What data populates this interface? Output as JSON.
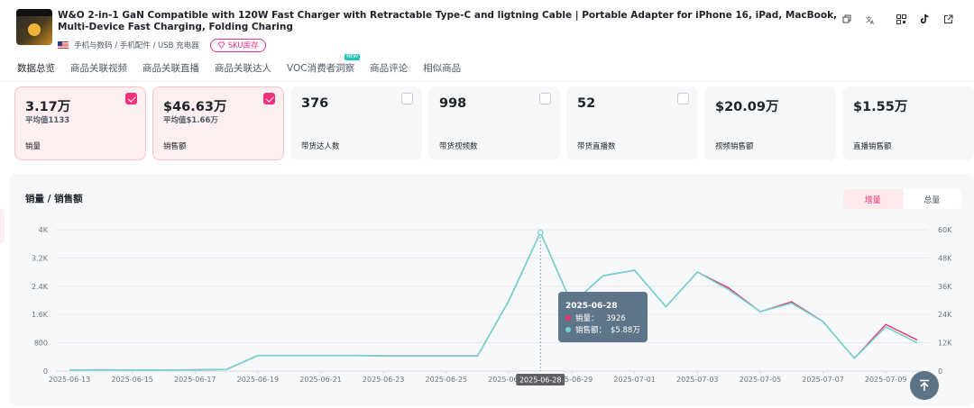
{
  "product": {
    "title": "W&O 2-in-1 GaN Compatible with 120W Fast Charger with Retractable Type-C and ligtning Cable | Portable Adapter for iPhone 16, iPad, MacBook, Multi-Device Fast Charging, Folding Charing",
    "category_path": "手机与数码 / 手机配件 / USB 充电器",
    "sku_label": "SKU库存",
    "header_icons": [
      "copy-icon",
      "translate-icon",
      "qr-code-icon",
      "tiktok-icon",
      "external-link-icon"
    ]
  },
  "tabs": [
    {
      "label": "数据总览",
      "active": true
    },
    {
      "label": "商品关联视频"
    },
    {
      "label": "商品关联直播"
    },
    {
      "label": "商品关联达人"
    },
    {
      "label": "VOC消费者洞察",
      "badge": "NEW"
    },
    {
      "label": "商品评论"
    },
    {
      "label": "相似商品"
    }
  ],
  "metrics": [
    {
      "value": "3.17万",
      "sub": "平均值1133",
      "label": "销量",
      "selected": true
    },
    {
      "value": "$46.63万",
      "sub": "平均值$1.66万",
      "label": "销售额",
      "selected": true
    },
    {
      "value": "376",
      "sub": "",
      "label": "带货达人数",
      "selected": false
    },
    {
      "value": "998",
      "sub": "",
      "label": "带货视频数",
      "selected": false
    },
    {
      "value": "52",
      "sub": "",
      "label": "带货直播数",
      "selected": false
    },
    {
      "value": "$20.09万",
      "sub": "",
      "label": "视频销售额",
      "selected": false
    },
    {
      "value": "$1.55万",
      "sub": "",
      "label": "直播销售额",
      "selected": false
    }
  ],
  "chart_panel": {
    "title": "销量 / 销售额",
    "toggle": [
      "增量",
      "总量"
    ],
    "active_toggle": "增量"
  },
  "colors": {
    "accent": "#f0307a",
    "sales_volume": "#e8356b",
    "sales_amount": "#6fd3d3",
    "tooltip_bg": "#5e7489"
  },
  "tooltip": {
    "date": "2025-06-28",
    "volume_label": "销量：",
    "volume_value": "3926",
    "amount_label": "销售额：",
    "amount_value": "$5.88万"
  },
  "chart_data": {
    "type": "line",
    "title": "销量 / 销售额",
    "x": [
      "2025-06-13",
      "2025-06-14",
      "2025-06-15",
      "2025-06-16",
      "2025-06-17",
      "2025-06-18",
      "2025-06-19",
      "2025-06-20",
      "2025-06-21",
      "2025-06-22",
      "2025-06-23",
      "2025-06-24",
      "2025-06-25",
      "2025-06-26",
      "2025-06-27",
      "2025-06-28",
      "2025-06-29",
      "2025-06-30",
      "2025-07-01",
      "2025-07-02",
      "2025-07-03",
      "2025-07-04",
      "2025-07-05",
      "2025-07-06",
      "2025-07-07",
      "2025-07-08",
      "2025-07-09",
      "2025-07-10"
    ],
    "x_tick_labels": [
      "2025-06-13",
      "2025-06-15",
      "2025-06-17",
      "2025-06-19",
      "2025-06-21",
      "2025-06-23",
      "2025-06-25",
      "2025-06-27",
      "2025-06-29",
      "2025-07-01",
      "2025-07-03",
      "2025-07-05",
      "2025-07-07",
      "2025-07-09"
    ],
    "y_left_ticks": [
      "0",
      "800",
      "1.6K",
      "2.4K",
      "3.2K",
      "4K"
    ],
    "y_right_ticks": [
      "0",
      "12K",
      "24K",
      "36K",
      "48K",
      "60K"
    ],
    "ylim_left": [
      0,
      4000
    ],
    "ylim_right": [
      0,
      60000
    ],
    "series": [
      {
        "name": "销量",
        "axis": "left",
        "values": [
          30,
          35,
          30,
          30,
          35,
          45,
          440,
          440,
          440,
          440,
          430,
          430,
          430,
          430,
          2000,
          3926,
          1900,
          2700,
          2850,
          1820,
          2800,
          2350,
          1680,
          1960,
          1400,
          360,
          1320,
          880
        ]
      },
      {
        "name": "销售额",
        "axis": "right",
        "values": [
          450,
          525,
          450,
          450,
          525,
          675,
          6600,
          6600,
          6600,
          6600,
          6450,
          6450,
          6450,
          6450,
          30000,
          58800,
          28500,
          40500,
          42750,
          27300,
          42000,
          34500,
          25200,
          28800,
          21000,
          5400,
          18750,
          12000
        ]
      }
    ],
    "grid": true,
    "legend": "none"
  }
}
